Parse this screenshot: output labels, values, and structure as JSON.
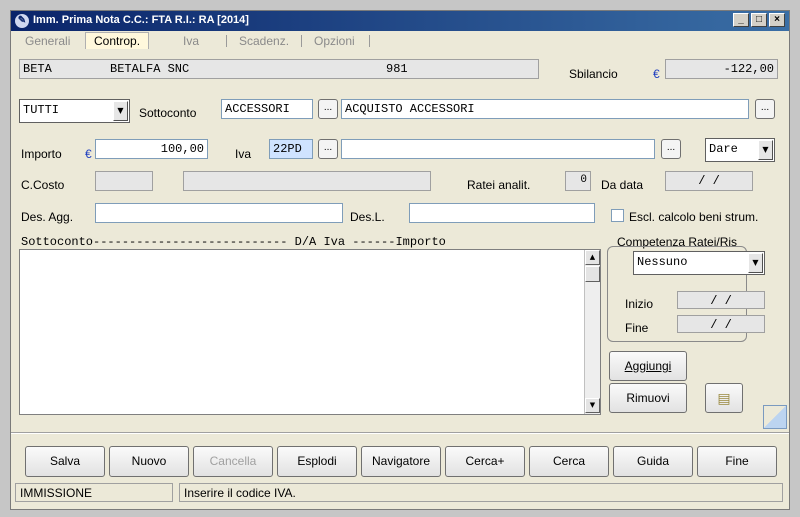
{
  "window": {
    "title": "Imm. Prima Nota C.C.: FTA  R.I.: RA  [2014]",
    "buttons": {
      "minimize": "_",
      "maximize": "□",
      "close": "×"
    }
  },
  "tabs": [
    {
      "label": "Generali",
      "active": false
    },
    {
      "label": "Controp.",
      "active": true
    },
    {
      "label": "Iva",
      "active": false
    },
    {
      "label": "Scadenz.",
      "active": false
    },
    {
      "label": "Opzioni",
      "active": false
    }
  ],
  "header": {
    "code": "BETA",
    "name": "BETALFA SNC",
    "number": "981",
    "sbilancio_label": "Sbilancio",
    "currency": "€",
    "sbilancio_value": "-122,00"
  },
  "row2": {
    "filter_value": "TUTTI",
    "sottoconto_label": "Sottoconto",
    "sottoconto_code": "ACCESSORI",
    "sottoconto_desc": "ACQUISTO ACCESSORI",
    "dots": "..."
  },
  "row3": {
    "importo_label": "Importo",
    "currency": "€",
    "importo_value": "100,00",
    "iva_label": "Iva",
    "iva_code": "22PD",
    "iva_desc": "",
    "dare_avere": "Dare"
  },
  "row4": {
    "ccosto_label": "C.Costo",
    "ccosto_code": "",
    "ccosto_desc": "",
    "ratei_label": "Ratei analit.",
    "ratei_value": "0",
    "dadata_label": "Da data",
    "dadata_value": "/ /"
  },
  "row5": {
    "desagg_label": "Des. Agg.",
    "desagg_value": "",
    "desl_label": "Des.L.",
    "desl_value": "",
    "escl_label": "Escl. calcolo beni strum.",
    "escl_checked": false
  },
  "grid": {
    "header": "Sottoconto--------------------------- D/A  Iva   ------Importo",
    "rows": []
  },
  "competenza": {
    "title": "Competenza Ratei/Ris",
    "mode": "Nessuno",
    "inizio_label": "Inizio",
    "inizio_value": "/ /",
    "fine_label": "Fine",
    "fine_value": "/ /"
  },
  "actions": {
    "aggiungi": "Aggiungi",
    "rimuovi": "Rimuovi"
  },
  "toolbar": [
    {
      "label": "Salva",
      "enabled": true
    },
    {
      "label": "Nuovo",
      "enabled": true
    },
    {
      "label": "Cancella",
      "enabled": false
    },
    {
      "label": "Esplodi",
      "enabled": true
    },
    {
      "label": "Navigatore",
      "enabled": true
    },
    {
      "label": "Cerca+",
      "enabled": true
    },
    {
      "label": "Cerca",
      "enabled": true
    },
    {
      "label": "Guida",
      "enabled": true
    },
    {
      "label": "Fine",
      "enabled": true
    }
  ],
  "status": {
    "mode": "IMMISSIONE",
    "message": "Inserire il codice IVA."
  },
  "colors": {
    "title_bar": "#0a246a",
    "background": "#ece9d8",
    "euro": "#1f3fbf",
    "active_field": "#cfe3ff"
  }
}
